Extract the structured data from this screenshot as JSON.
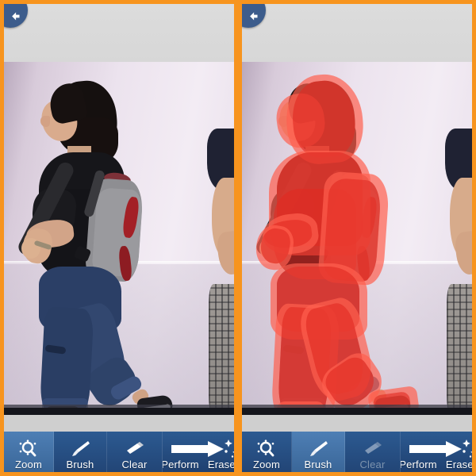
{
  "app": {
    "accent_orange": "#f7941e",
    "toolbar_blue": "#2c5a91",
    "toolbar_blue_selected": "#4e7fb5",
    "mask_red": "#e02a22",
    "mask_red_halo": "#ff5f4f",
    "disabled_text": "#7c93ae"
  },
  "panels": [
    {
      "id": "before",
      "back_icon": "back-arrow-icon",
      "image": {
        "description": "Woman walking with grey and red backpack against a light lavender studio wall; second person partially visible at right edge",
        "mask_visible": false
      },
      "toolbar": {
        "zoom": {
          "label": "Zoom",
          "icon": "zoom-magnifier-icon",
          "selected": true,
          "enabled": true
        },
        "brush": {
          "label": "Brush",
          "icon": "paintbrush-icon",
          "selected": false,
          "enabled": true
        },
        "clear": {
          "label": "Clear",
          "icon": "eraser-icon",
          "selected": false,
          "enabled": true
        },
        "perform": {
          "label": "Perform",
          "label2": "Erase",
          "icon": "arrow-sparkle-icon",
          "enabled": true
        }
      }
    },
    {
      "id": "after",
      "back_icon": "back-arrow-icon",
      "image": {
        "description": "Same photo with the main subject covered by a semi-transparent red selection mask",
        "mask_visible": true
      },
      "toolbar": {
        "zoom": {
          "label": "Zoom",
          "icon": "zoom-magnifier-icon",
          "selected": false,
          "enabled": true
        },
        "brush": {
          "label": "Brush",
          "icon": "paintbrush-icon",
          "selected": true,
          "enabled": true
        },
        "clear": {
          "label": "Clear",
          "icon": "eraser-icon",
          "selected": false,
          "enabled": false
        },
        "perform": {
          "label": "Perform",
          "label2": "Erase",
          "icon": "arrow-sparkle-icon",
          "enabled": true
        }
      }
    }
  ]
}
